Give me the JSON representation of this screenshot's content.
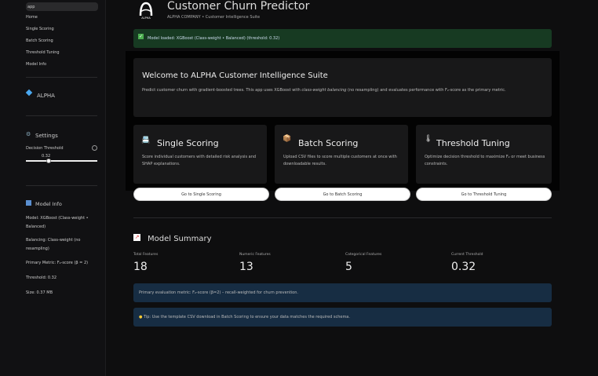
{
  "sidebar": {
    "app_label": "app",
    "nav": [
      "Home",
      "Single Scoring",
      "Batch Scoring",
      "Threshold Tuning",
      "Model Info"
    ],
    "brand": "ALPHA",
    "settings_title": "Settings",
    "threshold_label": "Decision Threshold",
    "threshold_value": "0.32",
    "threshold_fraction": 0.32,
    "model_info_title": "Model Info",
    "model_info": [
      "Model: XGBoost (Class-weight • Balanced)",
      "Balancing: Class-weight (no resampling)",
      "Primary Metric: F₂-score (β = 2)",
      "Threshold: 0.32",
      "Size: 0.37 MB"
    ]
  },
  "header": {
    "logo_text": "ALPHA",
    "title": "Customer Churn Predictor",
    "subtitle": "ALPHA COMPANY • Customer Intelligence Suite"
  },
  "status": "Model loaded: XGBoost (Class-weight • Balanced) (threshold: 0.32)",
  "welcome": {
    "title": "Welcome to ALPHA Customer Intelligence Suite",
    "text_a": "Predict customer churn with gradient-boosted trees. This app uses XGBoost with ",
    "text_em": "class-weight balancing",
    "text_b": " (no resampling) and evaluates performance with F₂-score as the primary metric."
  },
  "cards": [
    {
      "icon": "📇",
      "title": "Single Scoring",
      "desc": "Score individual customers with detailed risk analysis and SHAP explanations.",
      "button": "Go to Single Scoring"
    },
    {
      "icon": "📦",
      "title": "Batch Scoring",
      "desc": "Upload CSV files to score multiple customers at once with downloadable results.",
      "button": "Go to Batch Scoring"
    },
    {
      "icon": "🌡",
      "title": "Threshold Tuning",
      "desc": "Optimize decision threshold to maximize F₂ or meet business constraints.",
      "button": "Go to Threshold Tuning"
    }
  ],
  "summary": {
    "title": "Model Summary",
    "metrics": [
      {
        "label": "Total Features",
        "value": "18"
      },
      {
        "label": "Numeric Features",
        "value": "13"
      },
      {
        "label": "Categorical Features",
        "value": "5"
      },
      {
        "label": "Current Threshold",
        "value": "0.32"
      }
    ],
    "info": "Primary evaluation metric: F₂-score (β=2) – recall-weighted for churn prevention.",
    "tip": "Tip: Use the template CSV download in Batch Scoring to ensure your data matches the required schema."
  }
}
